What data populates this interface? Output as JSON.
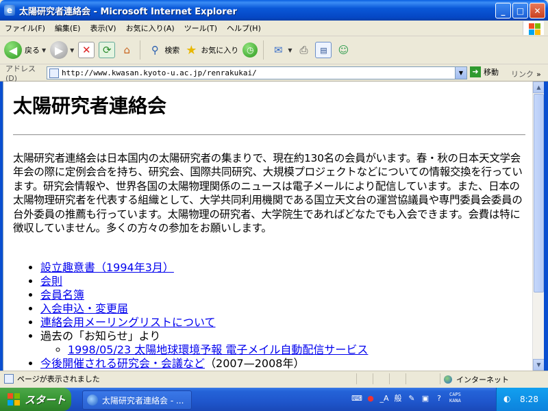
{
  "window": {
    "title": "太陽研究者連絡会 - Microsoft Internet Explorer",
    "controls": {
      "minimize": "_",
      "maximize": "□",
      "close": "✕"
    }
  },
  "menu": {
    "items": [
      "ファイル(F)",
      "編集(E)",
      "表示(V)",
      "お気に入り(A)",
      "ツール(T)",
      "ヘルプ(H)"
    ]
  },
  "toolbar": {
    "back_label": "戻る",
    "search_label": "検索",
    "favorites_label": "お気に入り"
  },
  "address": {
    "label": "アドレス(D)",
    "url": "http://www.kwasan.kyoto-u.ac.jp/renrakukai/",
    "go_label": "移動",
    "links_label": "リンク",
    "links_more": "»"
  },
  "page": {
    "title": "太陽研究者連絡会",
    "intro": "太陽研究者連絡会は日本国内の太陽研究者の集まりで、現在約130名の会員がいます。春・秋の日本天文学会年会の際に定例会合を持ち、研究会、国際共同研究、大規模プロジェクトなどについての情報交換を行っています。研究会情報や、世界各国の太陽物理関係のニュースは電子メールにより配信しています。また、日本の太陽物理研究者を代表する組織として、大学共同利用機関である国立天文台の運営協議員や専門委員会委員の台外委員の推薦も行っています。太陽物理の研究者、大学院生であればどなたでも入会できます。会費は特に徴収していません。多くの方々の参加をお願いします。",
    "links": [
      "設立趣意書（1994年3月）",
      "会則",
      "会員名簿",
      "入会申込・変更届",
      "連絡会用メーリングリストについて"
    ],
    "past_notice_label": "過去の「お知らせ」より",
    "past_notice_link": "1998/05/23 太陽地球環境予報 電子メイル自動配信サービス",
    "upcoming_link": "今後開催される研究会・会議など",
    "upcoming_suffix": "（2007—2008年）"
  },
  "status": {
    "text": "ページが表示されました",
    "zone": "インターネット"
  },
  "taskbar": {
    "start_label": "スタート",
    "task_label": "太陽研究者連絡会 - ...",
    "ime_text": "般",
    "ime_mode": "_A",
    "caps": "CAPS",
    "kana": "KANA",
    "clock": "8:28"
  },
  "colors": {
    "title_bar": "#0a58d8",
    "link": "#0000ee",
    "start_button": "#3b9a37",
    "taskbar": "#2463d8"
  }
}
